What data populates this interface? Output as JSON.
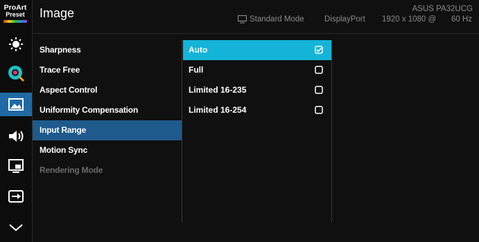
{
  "header": {
    "title": "Image",
    "model": "ASUS PA32UCG",
    "mode": "Standard Mode",
    "input": "DisplayPort",
    "resolution": "1920 x 1080 @",
    "refresh": "60 Hz"
  },
  "logo": {
    "line1": "ProArt",
    "line2": "Preset"
  },
  "rail": {
    "items": [
      {
        "icon": "brightness-icon"
      },
      {
        "icon": "color-icon"
      },
      {
        "icon": "image-icon",
        "active": true
      },
      {
        "icon": "sound-icon"
      },
      {
        "icon": "pip-icon"
      },
      {
        "icon": "input-select-icon"
      },
      {
        "icon": "chevron-down-icon"
      }
    ]
  },
  "menu": {
    "items": [
      {
        "label": "Sharpness"
      },
      {
        "label": "Trace Free"
      },
      {
        "label": "Aspect Control"
      },
      {
        "label": "Uniformity Compensation"
      },
      {
        "label": "Input Range",
        "active": true
      },
      {
        "label": "Motion Sync"
      },
      {
        "label": "Rendering Mode",
        "disabled": true
      }
    ]
  },
  "options": {
    "items": [
      {
        "label": "Auto",
        "selected": true,
        "checked": true
      },
      {
        "label": "Full",
        "checked": false
      },
      {
        "label": "Limited 16-235",
        "checked": false
      },
      {
        "label": "Limited 16-254",
        "checked": false
      }
    ]
  },
  "colors": {
    "background": "#101010",
    "active_menu": "#1e5a8c",
    "selected_option": "#14b4d9",
    "rail_active": "#1f6aa5",
    "status_text": "#8a8a8a",
    "disabled_text": "#6b6b6b"
  }
}
